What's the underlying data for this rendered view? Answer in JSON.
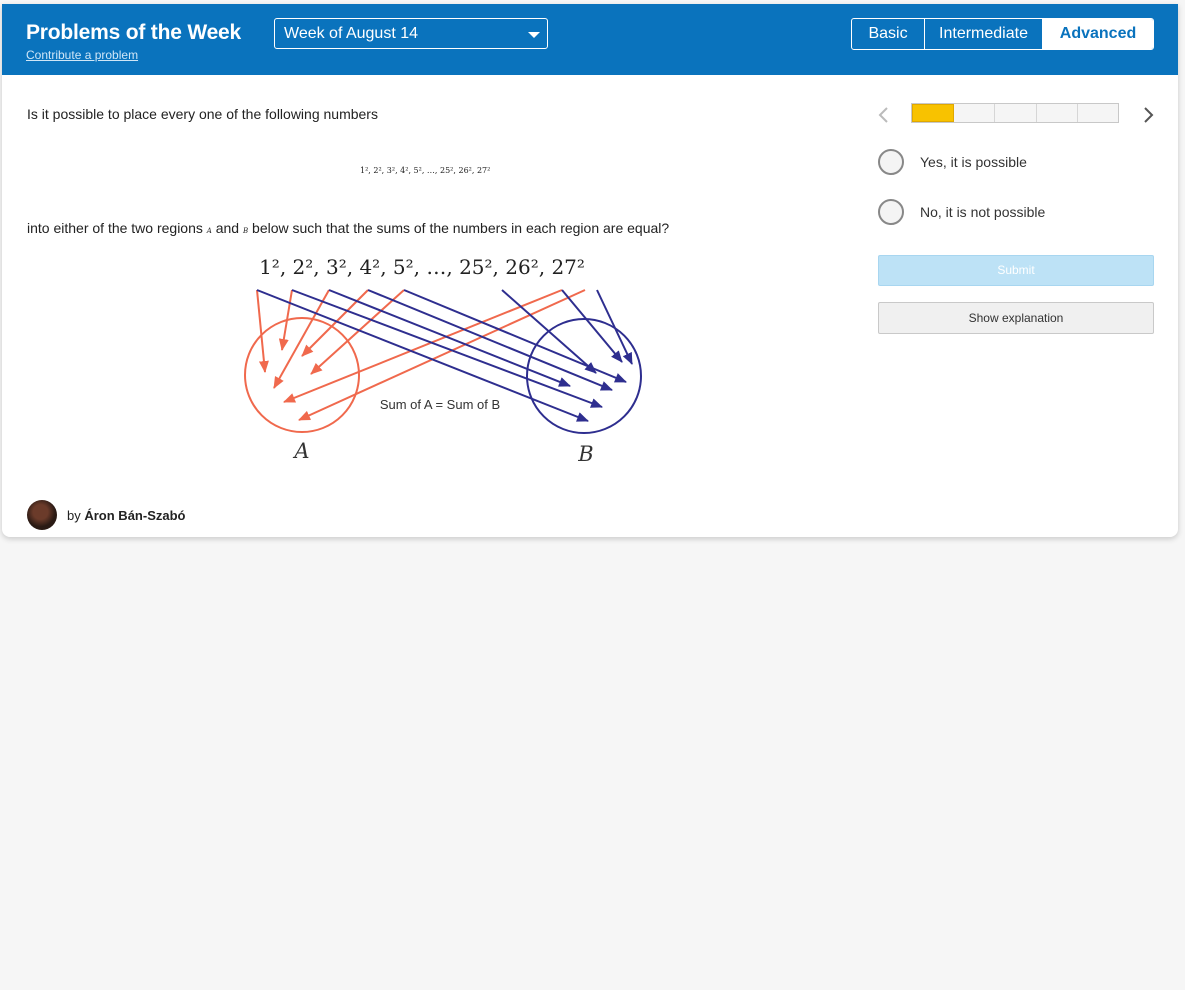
{
  "header": {
    "title": "Problems of the Week",
    "contribute_link": "Contribute a problem",
    "week_select": "Week of August 14",
    "levels": [
      "Basic",
      "Intermediate",
      "Advanced"
    ],
    "selected_level": "Advanced",
    "accent_color": "#0a73bd"
  },
  "question": {
    "intro": "Is it possible to place every one of the following numbers",
    "number_list": "1², 2², 3², 4², 5², …, 25², 26², 27²",
    "main_before": "into either of the two regions ",
    "region_a": "A",
    "main_and": " and ",
    "region_b": "B",
    "main_after": " below such that the sums of the numbers in each region are equal?"
  },
  "diagram": {
    "numbers_label": "1², 2², 3², 4², 5², …, 25², 26², 27²",
    "sum_label": "Sum of A = Sum of B",
    "label_a": "A",
    "label_b": "B",
    "color_a": "#f0694d",
    "color_b": "#2e2e8f"
  },
  "author": {
    "by": "by",
    "name": "Áron Bán-Szabó"
  },
  "sidebar": {
    "progress": {
      "current": 1,
      "total": 5
    },
    "progress_color": "#f8c200",
    "options": [
      "Yes, it is possible",
      "No, it is not possible"
    ],
    "submit_label": "Submit",
    "explain_label": "Show explanation"
  }
}
